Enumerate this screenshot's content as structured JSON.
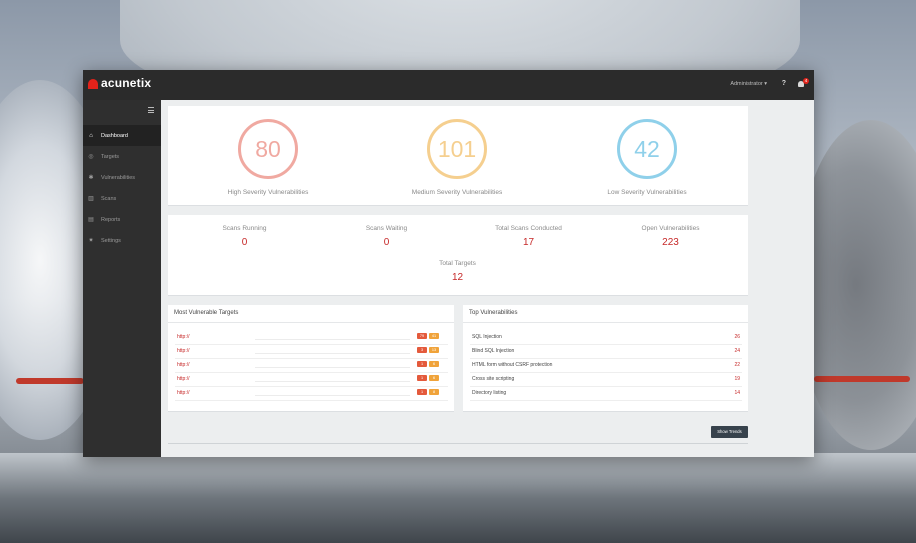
{
  "app": {
    "brand": "acunetix"
  },
  "topbar": {
    "user_label": "Administrator ▾",
    "help_label": "?",
    "notification_count": "4"
  },
  "sidebar": {
    "items": [
      {
        "label": "Dashboard",
        "icon": "dashboard-icon",
        "active": true
      },
      {
        "label": "Targets",
        "icon": "target-icon"
      },
      {
        "label": "Vulnerabilities",
        "icon": "bug-icon"
      },
      {
        "label": "Scans",
        "icon": "chart-icon"
      },
      {
        "label": "Reports",
        "icon": "report-icon"
      },
      {
        "label": "Settings",
        "icon": "gear-icon"
      }
    ]
  },
  "severity": [
    {
      "value": "80",
      "label": "High Severity Vulnerabilities",
      "color": "#f0a9a1"
    },
    {
      "value": "101",
      "label": "Medium Severity Vulnerabilities",
      "color": "#f5cf8f"
    },
    {
      "value": "42",
      "label": "Low Severity Vulnerabilities",
      "color": "#8fd0ea"
    }
  ],
  "stats": {
    "scans_running": {
      "label": "Scans Running",
      "value": "0"
    },
    "scans_waiting": {
      "label": "Scans Waiting",
      "value": "0"
    },
    "total_scans": {
      "label": "Total Scans Conducted",
      "value": "17"
    },
    "open_vulns": {
      "label": "Open Vulnerabilities",
      "value": "223"
    },
    "total_targets": {
      "label": "Total Targets",
      "value": "12"
    }
  },
  "most_vulnerable": {
    "title": "Most Vulnerable Targets",
    "rows": [
      {
        "link": "http://",
        "high": "79",
        "med": "41"
      },
      {
        "link": "http://",
        "high": "3",
        "med": "13"
      },
      {
        "link": "http://",
        "high": "1",
        "med": "6"
      },
      {
        "link": "http://",
        "high": "1",
        "med": "6"
      },
      {
        "link": "http://",
        "high": "1",
        "med": "8"
      }
    ]
  },
  "top_vulns": {
    "title": "Top Vulnerabilities",
    "rows": [
      {
        "name": "SQL Injection",
        "count": "26"
      },
      {
        "name": "Blind SQL Injection",
        "count": "24"
      },
      {
        "name": "HTML form without CSRF protection",
        "count": "22"
      },
      {
        "name": "Cross site scripting",
        "count": "19"
      },
      {
        "name": "Directory listing",
        "count": "14"
      }
    ]
  },
  "actions": {
    "show_trends": "Show Trends"
  }
}
